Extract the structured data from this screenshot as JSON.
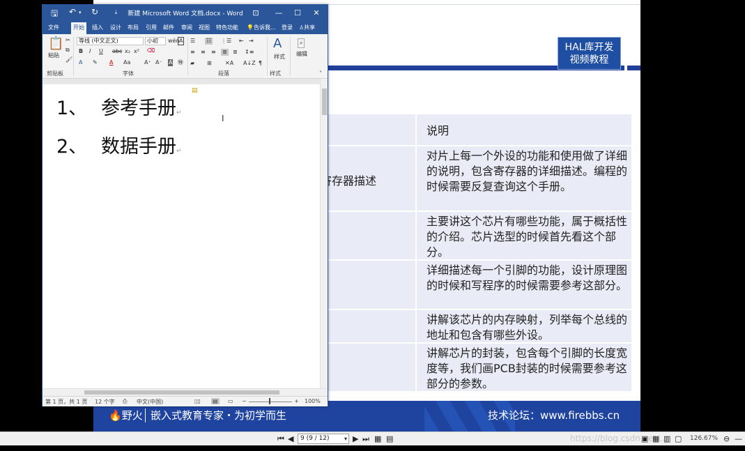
{
  "slide": {
    "badge_line1": "HAL库开发",
    "badge_line2": "视频教程",
    "table_header": "说明",
    "rows": [
      {
        "left": "寄存器描述",
        "text": "对片上每一个外设的功能和使用做了详细的说明，包含寄存器的详细描述。编程的时候需要反复查询这个手册。"
      },
      {
        "left": "",
        "text": "主要讲这个芯片有哪些功能，属于概括性的介绍。芯片选型的时候首先看这个部分。"
      },
      {
        "left": "",
        "text": "详细描述每一个引脚的功能，设计原理图的时候和写程序的时候需要参考这部分。"
      },
      {
        "left": "",
        "text": "讲解该芯片的内存映射，列举每个总线的地址和包含有哪些外设。"
      },
      {
        "left": "",
        "text": "讲解芯片的封装，包含每个引脚的长度宽度等，我们画PCB封装的时候需要参考这部分的参数。"
      }
    ],
    "footer_logo": "野火",
    "footer_slogan": "嵌入式教育专家・为初学而生",
    "footer_forum": "技术论坛：www.firebbs.cn"
  },
  "viewer": {
    "page_value": "9 (9 / 12)",
    "watermark": "https://blog.csdn.net/...",
    "zoom": "126.67%"
  },
  "word": {
    "title": "新建 Microsoft Word 文档.docx - Word",
    "tabs": [
      "文件",
      "开始",
      "插入",
      "设计",
      "布局",
      "引用",
      "邮件",
      "审阅",
      "视图",
      "特色功能"
    ],
    "tell_me": "告诉我...",
    "login": "登录",
    "share": "共享",
    "font_name": "等线 (中文正文)",
    "font_size": "小初",
    "paste_label": "粘贴",
    "styles_label": "样式",
    "editing_label": "编辑",
    "group_clipboard": "剪贴板",
    "group_font": "字体",
    "group_paragraph": "段落",
    "group_styles": "样式",
    "doc_lines": [
      {
        "num": "1、",
        "text": "参考手册"
      },
      {
        "num": "2、",
        "text": "数据手册"
      }
    ],
    "status_page": "第 1 页，共 1 页",
    "status_words": "12 个字",
    "status_lang": "中文(中国)",
    "status_zoom": "100%"
  },
  "colors": {
    "word_blue": "#2b579a",
    "slide_blue": "#1f44a0",
    "table_bg": "#e9ecf6"
  }
}
